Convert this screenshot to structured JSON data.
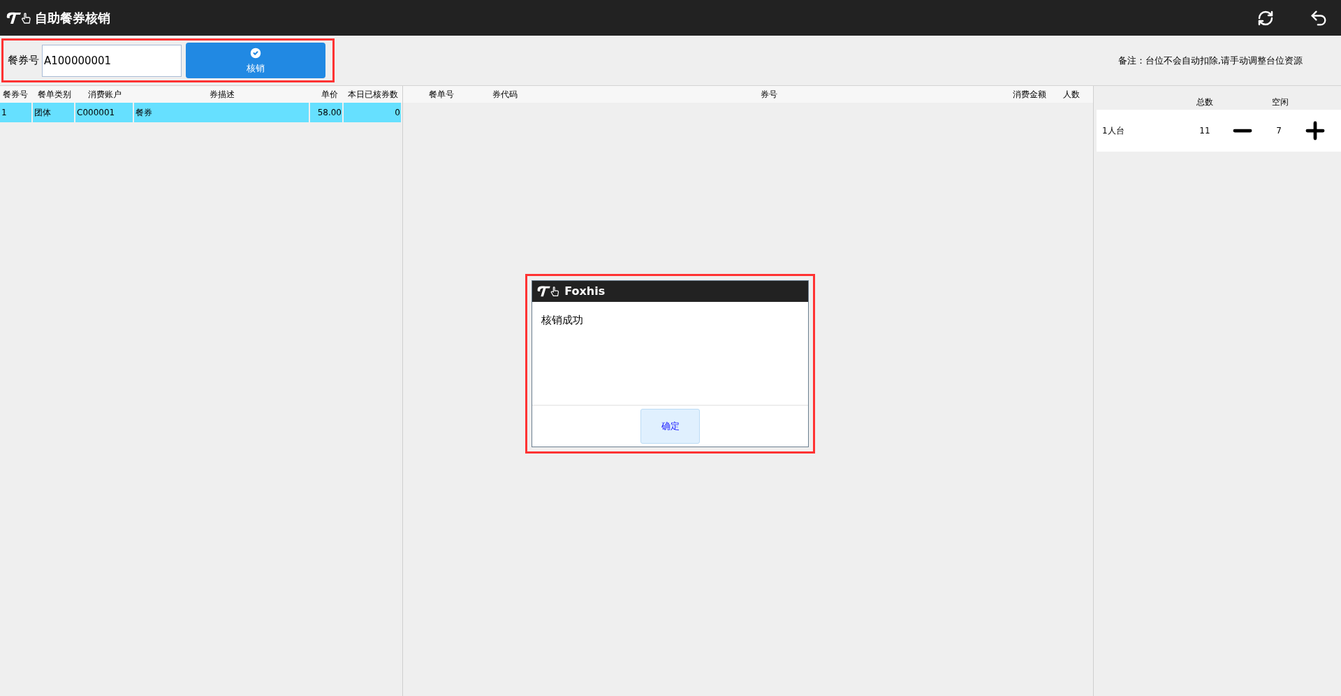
{
  "header": {
    "title": "自助餐券核销"
  },
  "toolbar": {
    "highlighted": true,
    "voucher_label": "餐券号",
    "voucher_value": "A100000001",
    "verify_button": "核销",
    "note": "备注：台位不会自动扣除,请手动调整台位资源"
  },
  "voucher_table": {
    "columns": [
      "餐券号",
      "餐单类别",
      "消费账户",
      "券描述",
      "单价",
      "本日已核券数"
    ],
    "rows": [
      {
        "selected": true,
        "cells": [
          "1",
          "团体",
          "C000001",
          "餐券",
          "58.00",
          "0"
        ]
      }
    ]
  },
  "detail_table": {
    "columns": [
      "餐单号",
      "券代码",
      "券号",
      "消费金额",
      "人数"
    ]
  },
  "seat_panel": {
    "columns": [
      "总数",
      "空闲"
    ],
    "rows": [
      {
        "name": "1人台",
        "total": "11",
        "free": "7"
      }
    ]
  },
  "dialog": {
    "highlighted": true,
    "title": "Foxhis",
    "message": "核销成功",
    "ok_button": "确定"
  }
}
